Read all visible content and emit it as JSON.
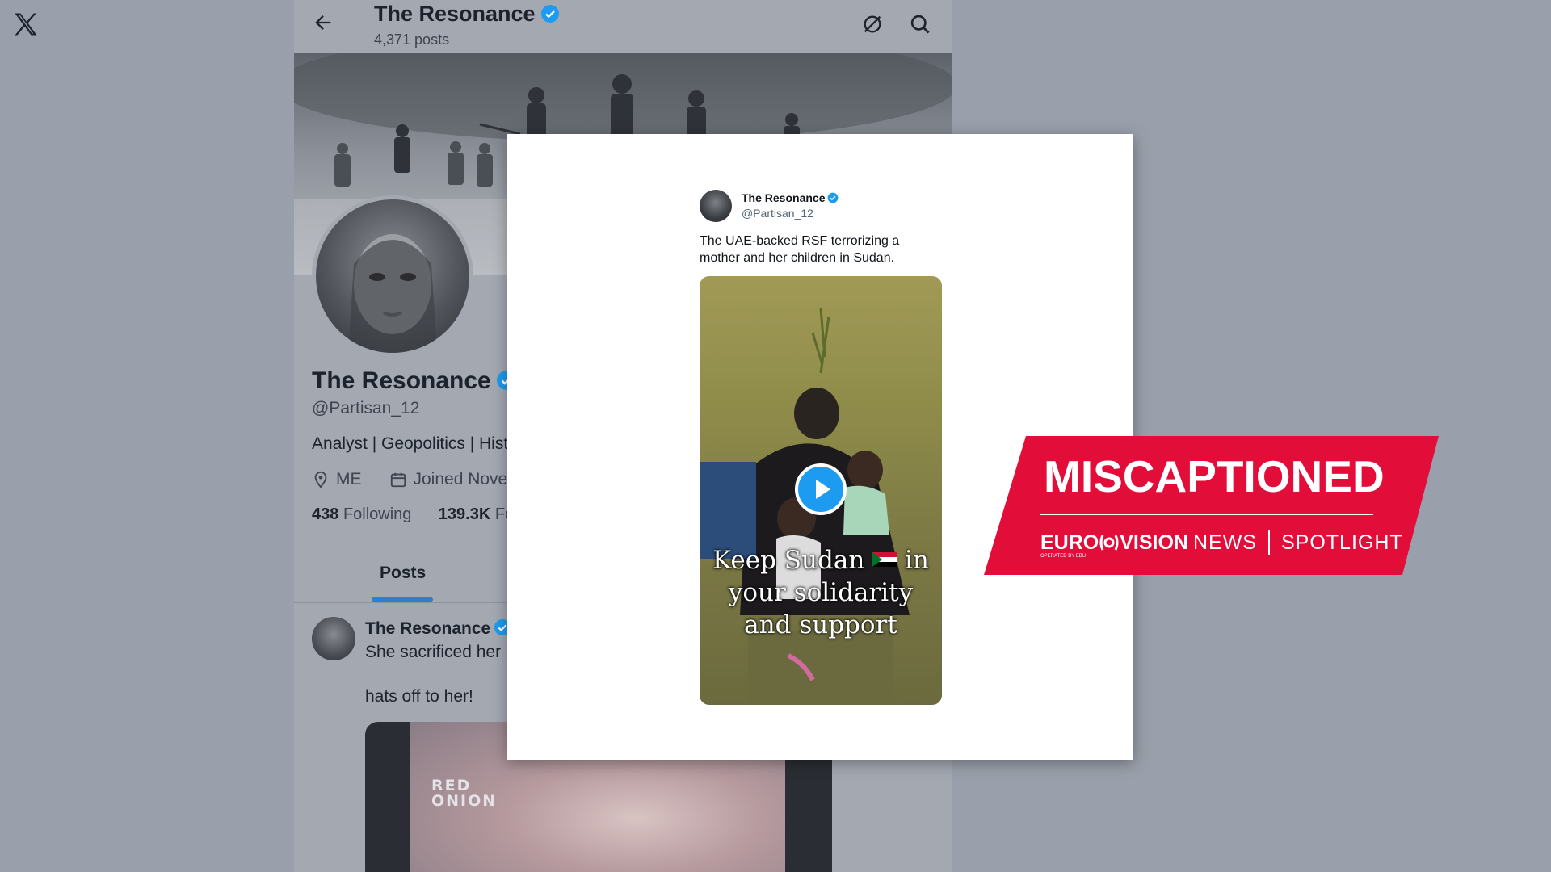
{
  "app": {
    "logo": "x-logo-icon"
  },
  "profile_header": {
    "name": "The Resonance",
    "posts_count": "4,371 posts",
    "icons": [
      "back-arrow-icon",
      "grok-icon",
      "search-icon"
    ]
  },
  "profile": {
    "name": "The Resonance",
    "handle": "@Partisan_12",
    "bio": "Analyst | Geopolitics | Hist",
    "location": "ME",
    "joined": "Joined Novem",
    "following_count": "438",
    "following_label": "Following",
    "followers_count": "139.3K",
    "followers_label": "Fo"
  },
  "tabs": [
    {
      "label": "Posts",
      "active": true
    }
  ],
  "background_post": {
    "author": "The Resonance",
    "text_line1": "She sacrificed her",
    "text_line2": "hats off to her!",
    "media_watermark_line1": "RED",
    "media_watermark_line2": "ONION"
  },
  "overlay_tweet": {
    "author": "The Resonance",
    "handle": "@Partisan_12",
    "text": "The UAE-backed RSF terrorizing a mother and her children in Sudan.",
    "video_caption_line1_a": "Keep Sudan",
    "video_caption_line1_b": "in",
    "video_caption_line2": "your solidarity",
    "video_caption_line3": "and support"
  },
  "badge": {
    "title": "MISCAPTIONED",
    "brand_euro": "EURO",
    "brand_vision": "VISION",
    "brand_news": "NEWS",
    "brand_spotlight": "SPOTLIGHT",
    "operated_by": "OPERATED BY EBU",
    "color": "#e30d3a"
  },
  "colors": {
    "page_background": "#9aa0ab",
    "verified_blue": "#1d9bf0",
    "tab_accent": "#2a7fd4"
  }
}
